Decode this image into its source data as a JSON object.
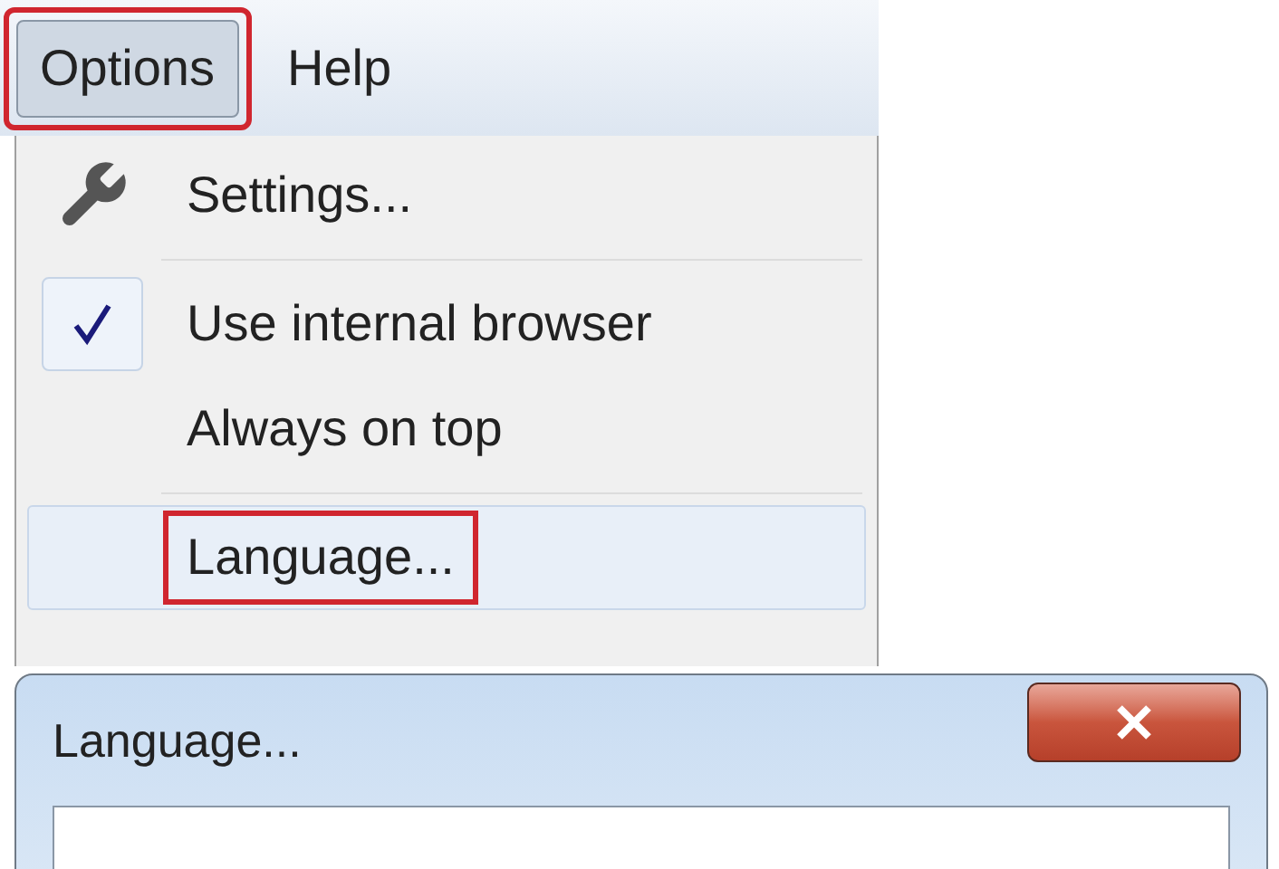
{
  "menubar": [
    {
      "label": "Options",
      "selected": true,
      "annotated": true
    },
    {
      "label": "Help",
      "selected": false,
      "annotated": false
    }
  ],
  "menu": [
    {
      "kind": "command",
      "label": "Settings...",
      "highlighted": false,
      "annotated": false
    },
    {
      "kind": "separator"
    },
    {
      "kind": "check",
      "label": "Use internal browser",
      "checked": true,
      "highlighted": false,
      "annotated": false
    },
    {
      "kind": "check",
      "label": "Always on top",
      "checked": false,
      "highlighted": false,
      "annotated": false
    },
    {
      "kind": "separator"
    },
    {
      "kind": "command",
      "label": "Language...",
      "highlighted": true,
      "annotated": true
    }
  ],
  "dialog": {
    "title": "Language..."
  }
}
